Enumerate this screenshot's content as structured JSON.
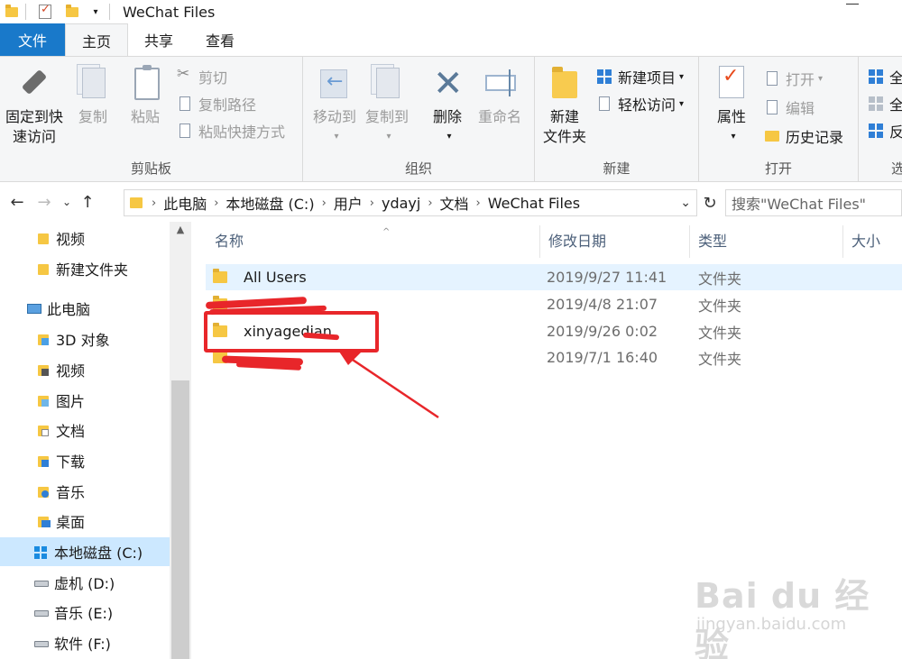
{
  "window": {
    "title": "WeChat Files"
  },
  "ribbon_tabs": [
    "文件",
    "主页",
    "共享",
    "查看"
  ],
  "ribbon": {
    "clipboard": {
      "label": "剪贴板",
      "pin_line1": "固定到快",
      "pin_line2": "速访问",
      "copy": "复制",
      "paste": "粘贴",
      "cut": "剪切",
      "copy_path": "复制路径",
      "paste_shortcut": "粘贴快捷方式"
    },
    "organize": {
      "label": "组织",
      "move_to": "移动到",
      "copy_to": "复制到",
      "delete": "删除",
      "rename": "重命名"
    },
    "new": {
      "label": "新建",
      "new_folder_line1": "新建",
      "new_folder_line2": "文件夹",
      "new_item": "新建项目",
      "easy_access": "轻松访问"
    },
    "open": {
      "label": "打开",
      "properties": "属性",
      "open": "打开",
      "edit": "编辑",
      "history": "历史记录"
    },
    "select": {
      "label": "选",
      "select_all": "全",
      "select_none": "全",
      "invert": "反"
    }
  },
  "address": {
    "crumbs": [
      "此电脑",
      "本地磁盘 (C:)",
      "用户",
      "ydayj",
      "文档",
      "WeChat Files"
    ]
  },
  "search": {
    "placeholder": "搜索\"WeChat Files\""
  },
  "nav_pane": {
    "items": [
      {
        "label": "视频",
        "icon": "folder-icon"
      },
      {
        "label": "新建文件夹",
        "icon": "folder-icon"
      },
      {
        "label": "此电脑",
        "icon": "computer-icon"
      },
      {
        "label": "3D 对象",
        "icon": "3d-objects-icon"
      },
      {
        "label": "视频",
        "icon": "videos-icon"
      },
      {
        "label": "图片",
        "icon": "pictures-icon"
      },
      {
        "label": "文档",
        "icon": "documents-icon"
      },
      {
        "label": "下载",
        "icon": "downloads-icon"
      },
      {
        "label": "音乐",
        "icon": "music-icon"
      },
      {
        "label": "桌面",
        "icon": "desktop-icon"
      },
      {
        "label": "本地磁盘 (C:)",
        "icon": "windows-drive-icon",
        "selected": true
      },
      {
        "label": "虚机 (D:)",
        "icon": "drive-icon"
      },
      {
        "label": "音乐 (E:)",
        "icon": "drive-icon"
      },
      {
        "label": "软件 (F:)",
        "icon": "drive-icon"
      }
    ]
  },
  "file_list": {
    "columns": [
      "名称",
      "修改日期",
      "类型",
      "大小"
    ],
    "rows": [
      {
        "name": "All Users",
        "date": "2019/9/27 11:41",
        "type": "文件夹"
      },
      {
        "name": "",
        "date": "2019/4/8 21:07",
        "type": "文件夹"
      },
      {
        "name": "xinyagedian",
        "date": "2019/9/26 0:02",
        "type": "文件夹"
      },
      {
        "name": "",
        "date": "2019/7/1 16:40",
        "type": "文件夹"
      }
    ]
  },
  "watermark": {
    "logo": "Bai du 经验",
    "url": "jingyan.baidu.com"
  },
  "colors": {
    "accent": "#1979ca",
    "annotation": "#e8262a",
    "selection": "#cce8ff"
  }
}
